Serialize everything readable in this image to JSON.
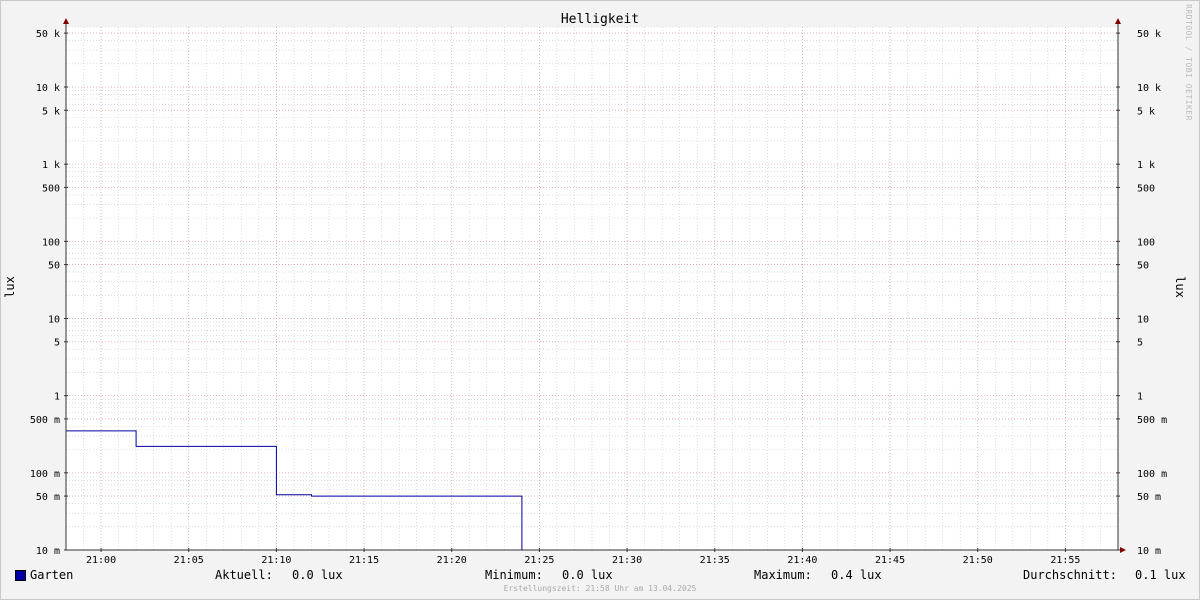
{
  "title": "Helligkeit",
  "watermark": "RRDTOOL / TOBI OETIKER",
  "footer": "Erstellungszeit: 21:58 Uhr am 13.04.2025",
  "colors": {
    "series": "#0000a0",
    "major_grid": "#e8a0a0",
    "minor_grid": "#c8c8c8",
    "arrow": "#800000"
  },
  "legend": {
    "series_name": "Garten",
    "current_label": "Aktuell:",
    "current_value": "0.0 lux",
    "min_label": "Minimum:",
    "min_value": "0.0 lux",
    "max_label": "Maximum:",
    "max_value": "0.4 lux",
    "avg_label": "Durchschnitt:",
    "avg_value": "0.1 lux"
  },
  "chart_data": {
    "type": "line",
    "title": "Helligkeit",
    "ylabel": "lux",
    "ylabel_right": "lux",
    "y_scale": "log",
    "ylim": [
      0.01,
      60000
    ],
    "xlim": [
      "20:58",
      "21:58"
    ],
    "grid": true,
    "x_ticks": [
      "21:00",
      "21:05",
      "21:10",
      "21:15",
      "21:20",
      "21:25",
      "21:30",
      "21:35",
      "21:40",
      "21:45",
      "21:50",
      "21:55"
    ],
    "y_ticks": [
      {
        "value": 50000,
        "label": "50 k"
      },
      {
        "value": 10000,
        "label": "10 k"
      },
      {
        "value": 5000,
        "label": "5 k"
      },
      {
        "value": 1000,
        "label": "1 k"
      },
      {
        "value": 500,
        "label": "500"
      },
      {
        "value": 100,
        "label": "100"
      },
      {
        "value": 50,
        "label": "50"
      },
      {
        "value": 10,
        "label": "10"
      },
      {
        "value": 5,
        "label": "5"
      },
      {
        "value": 1,
        "label": "1"
      },
      {
        "value": 0.5,
        "label": "500 m"
      },
      {
        "value": 0.1,
        "label": "100 m"
      },
      {
        "value": 0.05,
        "label": "50 m"
      },
      {
        "value": 0.01,
        "label": "10 m"
      }
    ],
    "series": [
      {
        "name": "Garten",
        "color": "#0000a0",
        "points": [
          [
            "20:58",
            0.35
          ],
          [
            "21:02",
            0.35
          ],
          [
            "21:02",
            0.22
          ],
          [
            "21:10",
            0.22
          ],
          [
            "21:10",
            0.052
          ],
          [
            "21:12",
            0.052
          ],
          [
            "21:12",
            0.05
          ],
          [
            "21:24",
            0.05
          ],
          [
            "21:24",
            0.01
          ],
          [
            "21:58",
            0.01
          ]
        ]
      }
    ]
  }
}
